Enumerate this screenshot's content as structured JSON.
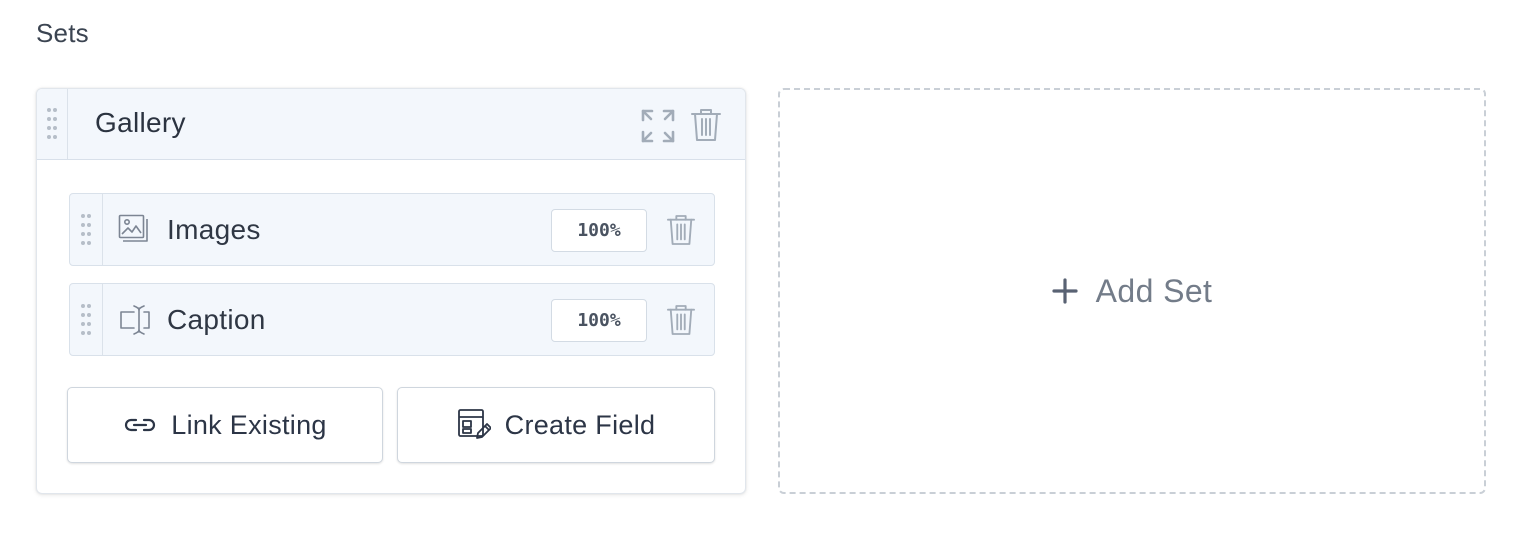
{
  "section": {
    "heading": "Sets"
  },
  "set": {
    "title": "Gallery",
    "fields": [
      {
        "label": "Images",
        "width": "100%",
        "icon": "image-gallery-icon"
      },
      {
        "label": "Caption",
        "width": "100%",
        "icon": "text-cursor-icon"
      }
    ],
    "buttons": {
      "link_existing": "Link Existing",
      "create_field": "Create Field"
    }
  },
  "add_set": {
    "label": "Add Set"
  },
  "colors": {
    "header_bg": "#f3f7fc",
    "border": "#d9e1ea",
    "icon": "#a2acb8",
    "text": "#2f3542",
    "add_set_text": "#737c89"
  }
}
